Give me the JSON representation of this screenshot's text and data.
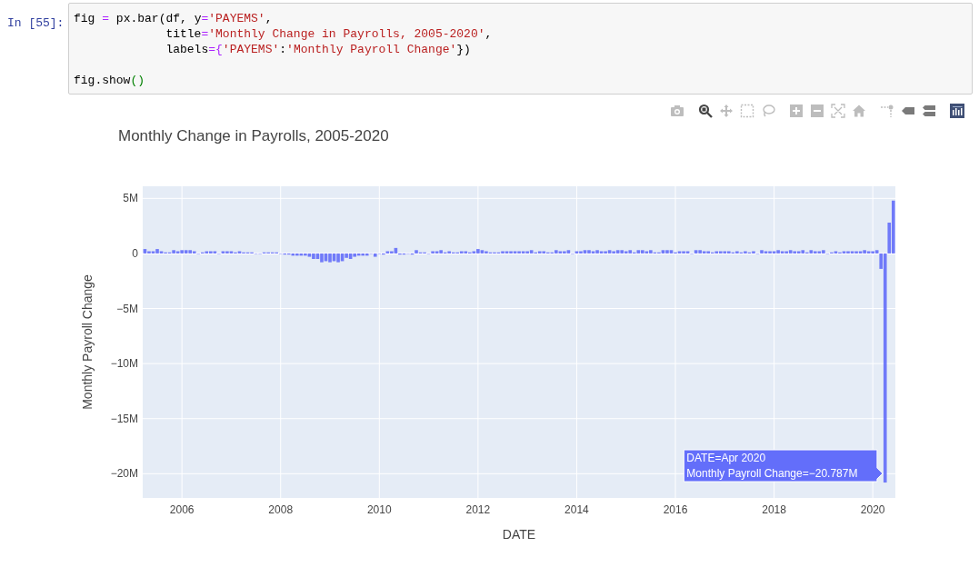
{
  "cell": {
    "prompt": "In [55]:",
    "code_blocks": [
      [
        [
          {
            "kind": "text",
            "text": "fig "
          },
          {
            "kind": "op",
            "text": "="
          },
          {
            "kind": "text",
            "text": " px.bar(df, y"
          },
          {
            "kind": "op",
            "text": "="
          },
          {
            "kind": "string",
            "text": "'PAYEMS'"
          },
          {
            "kind": "text",
            "text": ","
          }
        ],
        [
          {
            "kind": "text",
            "text": "             title"
          },
          {
            "kind": "op",
            "text": "="
          },
          {
            "kind": "string",
            "text": "'Monthly Change in Payrolls, 2005-2020'"
          },
          {
            "kind": "text",
            "text": ","
          }
        ],
        [
          {
            "kind": "text",
            "text": "             labels"
          },
          {
            "kind": "op",
            "text": "={"
          },
          {
            "kind": "string",
            "text": "'PAYEMS'"
          },
          {
            "kind": "text",
            "text": ":"
          },
          {
            "kind": "string",
            "text": "'Monthly Payroll Change'"
          },
          {
            "kind": "text",
            "text": "})"
          }
        ]
      ],
      [
        [
          {
            "kind": "text",
            "text": "fig.show"
          },
          {
            "kind": "builtin",
            "text": "()"
          }
        ]
      ]
    ]
  },
  "toolbar": [
    {
      "kind": "camera",
      "selected": false
    },
    {
      "kind": "zoom",
      "selected": true
    },
    {
      "kind": "pan",
      "selected": false
    },
    {
      "kind": "box-select",
      "selected": false
    },
    {
      "kind": "lasso",
      "selected": false
    },
    {
      "kind": "zoom-in",
      "selected": false
    },
    {
      "kind": "zoom-out",
      "selected": false
    },
    {
      "kind": "autoscale",
      "selected": false
    },
    {
      "kind": "home",
      "selected": false
    },
    {
      "kind": "spikelines",
      "selected": false
    },
    {
      "kind": "hover-closest",
      "selected": false
    },
    {
      "kind": "hover-compare",
      "selected": false
    }
  ],
  "chart_data": {
    "type": "bar",
    "title": "Monthly Change in Payrolls, 2005-2020",
    "xlabel": "DATE",
    "ylabel": "Monthly Payroll Change",
    "grid": true,
    "x": [
      "2005-04",
      "2005-05",
      "2005-06",
      "2005-07",
      "2005-08",
      "2005-09",
      "2005-10",
      "2005-11",
      "2005-12",
      "2006-01",
      "2006-02",
      "2006-03",
      "2006-04",
      "2006-05",
      "2006-06",
      "2006-07",
      "2006-08",
      "2006-09",
      "2006-10",
      "2006-11",
      "2006-12",
      "2007-01",
      "2007-02",
      "2007-03",
      "2007-04",
      "2007-05",
      "2007-06",
      "2007-07",
      "2007-08",
      "2007-09",
      "2007-10",
      "2007-11",
      "2007-12",
      "2008-01",
      "2008-02",
      "2008-03",
      "2008-04",
      "2008-05",
      "2008-06",
      "2008-07",
      "2008-08",
      "2008-09",
      "2008-10",
      "2008-11",
      "2008-12",
      "2009-01",
      "2009-02",
      "2009-03",
      "2009-04",
      "2009-05",
      "2009-06",
      "2009-07",
      "2009-08",
      "2009-09",
      "2009-10",
      "2009-11",
      "2009-12",
      "2010-01",
      "2010-02",
      "2010-03",
      "2010-04",
      "2010-05",
      "2010-06",
      "2010-07",
      "2010-08",
      "2010-09",
      "2010-10",
      "2010-11",
      "2010-12",
      "2011-01",
      "2011-02",
      "2011-03",
      "2011-04",
      "2011-05",
      "2011-06",
      "2011-07",
      "2011-08",
      "2011-09",
      "2011-10",
      "2011-11",
      "2011-12",
      "2012-01",
      "2012-02",
      "2012-03",
      "2012-04",
      "2012-05",
      "2012-06",
      "2012-07",
      "2012-08",
      "2012-09",
      "2012-10",
      "2012-11",
      "2012-12",
      "2013-01",
      "2013-02",
      "2013-03",
      "2013-04",
      "2013-05",
      "2013-06",
      "2013-07",
      "2013-08",
      "2013-09",
      "2013-10",
      "2013-11",
      "2013-12",
      "2014-01",
      "2014-02",
      "2014-03",
      "2014-04",
      "2014-05",
      "2014-06",
      "2014-07",
      "2014-08",
      "2014-09",
      "2014-10",
      "2014-11",
      "2014-12",
      "2015-01",
      "2015-02",
      "2015-03",
      "2015-04",
      "2015-05",
      "2015-06",
      "2015-07",
      "2015-08",
      "2015-09",
      "2015-10",
      "2015-11",
      "2015-12",
      "2016-01",
      "2016-02",
      "2016-03",
      "2016-04",
      "2016-05",
      "2016-06",
      "2016-07",
      "2016-08",
      "2016-09",
      "2016-10",
      "2016-11",
      "2016-12",
      "2017-01",
      "2017-02",
      "2017-03",
      "2017-04",
      "2017-05",
      "2017-06",
      "2017-07",
      "2017-08",
      "2017-09",
      "2017-10",
      "2017-11",
      "2017-12",
      "2018-01",
      "2018-02",
      "2018-03",
      "2018-04",
      "2018-05",
      "2018-06",
      "2018-07",
      "2018-08",
      "2018-09",
      "2018-10",
      "2018-11",
      "2018-12",
      "2019-01",
      "2019-02",
      "2019-03",
      "2019-04",
      "2019-05",
      "2019-06",
      "2019-07",
      "2019-08",
      "2019-09",
      "2019-10",
      "2019-11",
      "2019-12",
      "2020-01",
      "2020-02",
      "2020-03",
      "2020-04",
      "2020-05",
      "2020-06"
    ],
    "series": [
      {
        "color": "#636efa",
        "values": [
          0.4,
          0.2,
          0.2,
          0.4,
          0.2,
          0.1,
          0.1,
          0.3,
          0.2,
          0.3,
          0.3,
          0.3,
          0.2,
          0.0,
          0.1,
          0.2,
          0.2,
          0.2,
          0.0,
          0.2,
          0.2,
          0.2,
          0.1,
          0.2,
          0.1,
          0.1,
          0.1,
          0.0,
          0.0,
          0.1,
          0.1,
          0.1,
          0.1,
          0.0,
          -0.1,
          -0.1,
          -0.2,
          -0.2,
          -0.2,
          -0.2,
          -0.3,
          -0.5,
          -0.5,
          -0.8,
          -0.7,
          -0.8,
          -0.7,
          -0.8,
          -0.7,
          -0.4,
          -0.5,
          -0.3,
          -0.2,
          -0.2,
          -0.2,
          0.0,
          -0.3,
          0.0,
          -0.1,
          0.2,
          0.2,
          0.5,
          -0.1,
          -0.1,
          0.0,
          -0.1,
          0.3,
          0.1,
          0.1,
          0.0,
          0.2,
          0.2,
          0.3,
          0.1,
          0.2,
          0.1,
          0.1,
          0.2,
          0.2,
          0.1,
          0.2,
          0.4,
          0.3,
          0.2,
          0.1,
          0.1,
          0.1,
          0.2,
          0.2,
          0.2,
          0.2,
          0.2,
          0.2,
          0.2,
          0.3,
          0.1,
          0.2,
          0.2,
          0.1,
          0.1,
          0.3,
          0.2,
          0.2,
          0.3,
          0.0,
          0.2,
          0.2,
          0.3,
          0.3,
          0.2,
          0.3,
          0.2,
          0.2,
          0.3,
          0.2,
          0.3,
          0.3,
          0.2,
          0.3,
          0.1,
          0.3,
          0.3,
          0.2,
          0.3,
          0.1,
          0.1,
          0.3,
          0.3,
          0.3,
          0.1,
          0.2,
          0.2,
          0.2,
          0.0,
          0.3,
          0.3,
          0.2,
          0.2,
          0.1,
          0.2,
          0.2,
          0.2,
          0.2,
          0.1,
          0.2,
          0.1,
          0.2,
          0.1,
          0.2,
          0.0,
          0.3,
          0.2,
          0.2,
          0.2,
          0.3,
          0.2,
          0.2,
          0.3,
          0.2,
          0.2,
          0.3,
          0.1,
          0.3,
          0.2,
          0.2,
          0.3,
          0.0,
          0.1,
          0.2,
          0.1,
          0.2,
          0.2,
          0.2,
          0.2,
          0.2,
          0.3,
          0.2,
          0.2,
          0.3,
          -1.4,
          -20.8,
          2.8,
          4.8
        ]
      }
    ],
    "xlim": [
      "2005-03-15",
      "2020-06-16"
    ],
    "ylim": [
      -22.2,
      6.1
    ],
    "xticks": [
      {
        "value": "2006-01",
        "label": "2006"
      },
      {
        "value": "2008-01",
        "label": "2008"
      },
      {
        "value": "2010-01",
        "label": "2010"
      },
      {
        "value": "2012-01",
        "label": "2012"
      },
      {
        "value": "2014-01",
        "label": "2014"
      },
      {
        "value": "2016-01",
        "label": "2016"
      },
      {
        "value": "2018-01",
        "label": "2018"
      },
      {
        "value": "2020-01",
        "label": "2020"
      }
    ],
    "yticks": [
      {
        "value": 5,
        "label": "5M"
      },
      {
        "value": 0,
        "label": "0"
      },
      {
        "value": -5,
        "label": "−5M"
      },
      {
        "value": -10,
        "label": "−10M"
      },
      {
        "value": -15,
        "label": "−15M"
      },
      {
        "value": -20,
        "label": "−20M"
      }
    ]
  },
  "hover_label": {
    "lines": [
      "DATE=Apr 2020",
      "Monthly Payroll Change=−20.787M"
    ]
  }
}
